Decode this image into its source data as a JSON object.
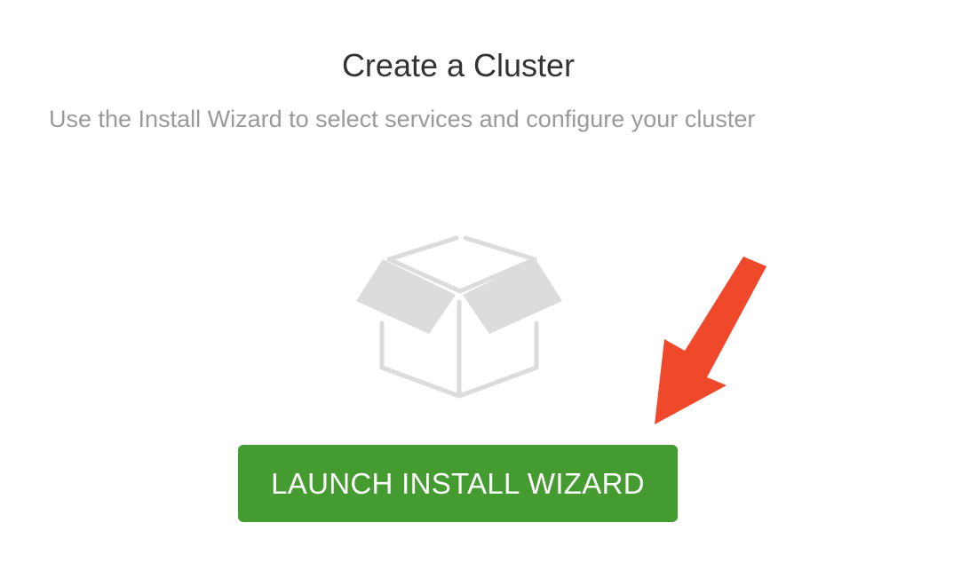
{
  "header": {
    "title": "Create a Cluster",
    "subtitle": "Use the Install Wizard to select services and configure your cluster"
  },
  "illustration": {
    "icon": "open-box-icon",
    "color": "#dcdcdc"
  },
  "annotation": {
    "icon": "arrow-pointer-icon",
    "color": "#f0482a"
  },
  "actions": {
    "launch_label": "LAUNCH INSTALL WIZARD",
    "launch_color": "#449b2f"
  }
}
